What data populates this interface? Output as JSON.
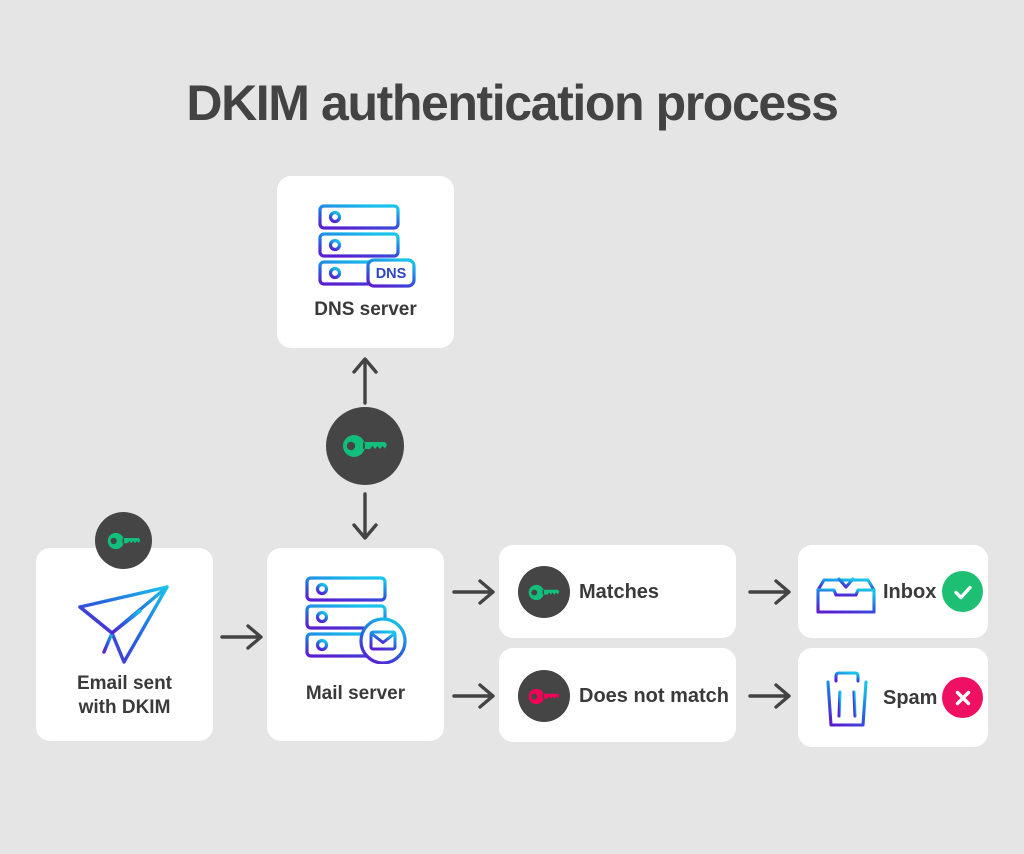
{
  "page": {
    "title": "DKIM authentication process",
    "background_color": "#e5e5e5"
  },
  "colors": {
    "accent_green": "#12be7c",
    "accent_pink": "#f50057",
    "dark_gray": "#454545",
    "text_dark": "#3a3a3a",
    "card_white": "#ffffff",
    "gradient_cyan": "#18b8e8",
    "gradient_blue": "#2663e0",
    "gradient_purple": "#5a1fd0"
  },
  "nodes": {
    "dns_server": {
      "label": "DNS server",
      "icon": "dns-server-icon",
      "badge_text": "DNS"
    },
    "email_sent": {
      "label": "Email sent\nwith DKIM",
      "icon": "paper-plane-icon",
      "key_badge": "green-key-icon"
    },
    "mail_server": {
      "label": "Mail server",
      "icon": "mail-server-icon"
    },
    "key_transit": {
      "icon": "green-key-icon"
    }
  },
  "results": [
    {
      "label": "Matches",
      "key_icon": "green-key-icon",
      "key_color": "#12be7c"
    },
    {
      "label": "Does not match",
      "key_icon": "pink-key-icon",
      "key_color": "#f50057"
    }
  ],
  "destinations": [
    {
      "label": "Inbox",
      "icon": "inbox-tray-icon",
      "status_icon": "check-circle-icon",
      "status_color": "#1dbf73"
    },
    {
      "label": "Spam",
      "icon": "trash-can-icon",
      "status_icon": "x-circle-icon",
      "status_color": "#ef0f63"
    }
  ],
  "arrows": [
    {
      "name": "arrow-mail-to-dns",
      "direction": "up"
    },
    {
      "name": "arrow-dns-to-mail",
      "direction": "down"
    },
    {
      "name": "arrow-email-to-mailserver",
      "direction": "right"
    },
    {
      "name": "arrow-mailserver-to-matches",
      "direction": "right"
    },
    {
      "name": "arrow-mailserver-to-nomatch",
      "direction": "right"
    },
    {
      "name": "arrow-matches-to-inbox",
      "direction": "right"
    },
    {
      "name": "arrow-nomatch-to-spam",
      "direction": "right"
    }
  ]
}
